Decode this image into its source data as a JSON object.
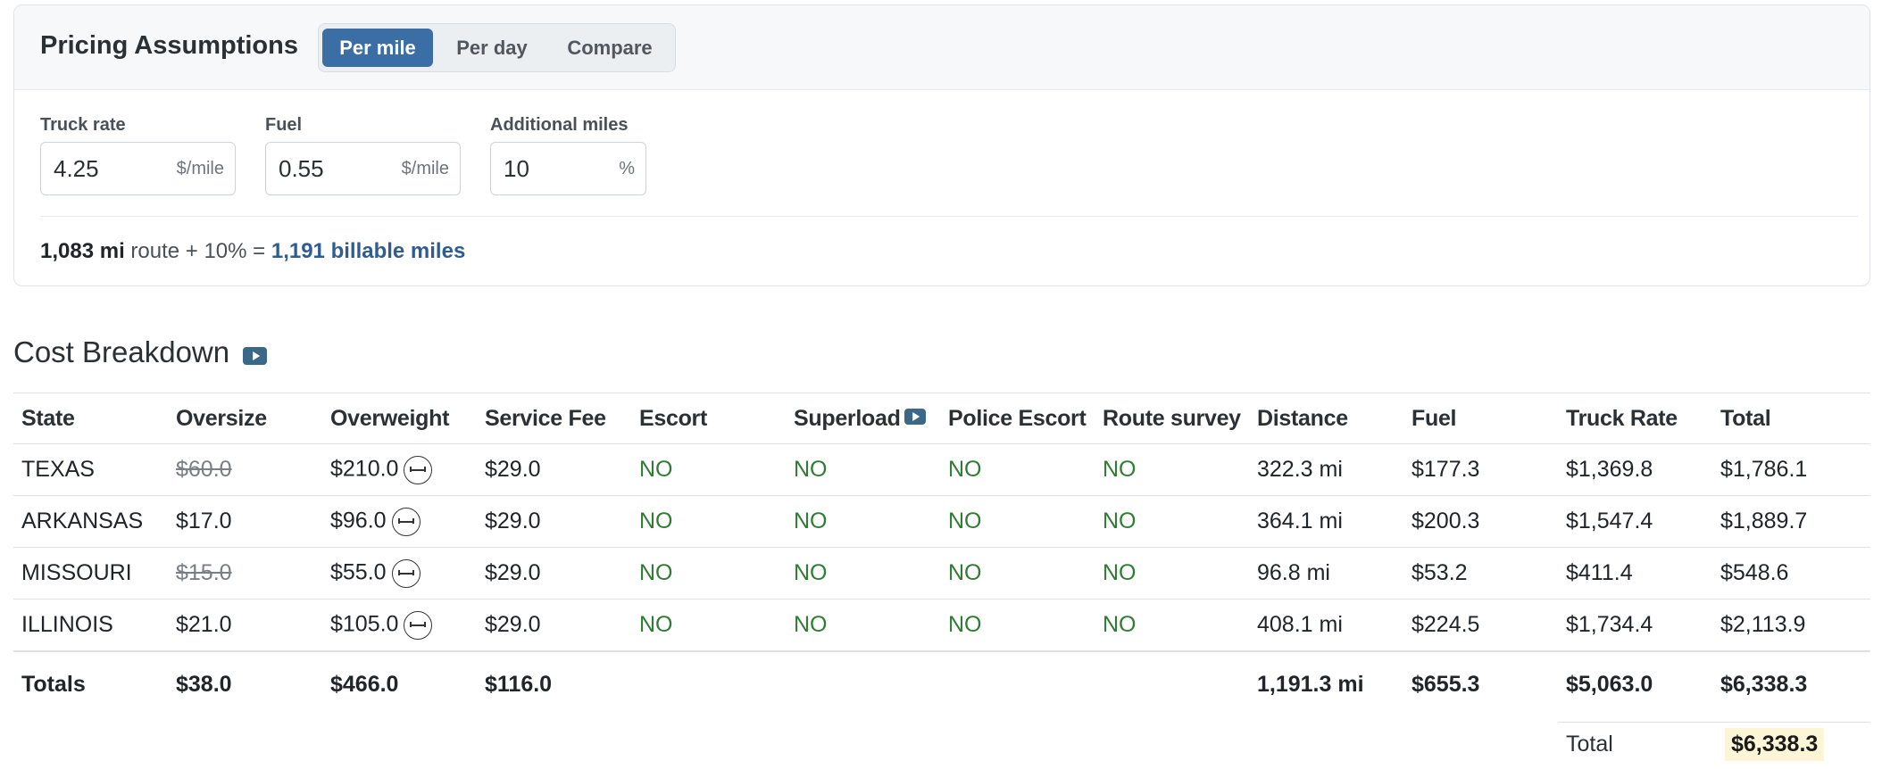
{
  "pricing": {
    "title": "Pricing Assumptions",
    "modes": [
      "Per mile",
      "Per day",
      "Compare"
    ],
    "active_mode": "Per mile",
    "fields": [
      {
        "label": "Truck rate",
        "value": "4.25",
        "unit": "$/mile"
      },
      {
        "label": "Fuel",
        "value": "0.55",
        "unit": "$/mile"
      },
      {
        "label": "Additional miles",
        "value": "10",
        "unit": "%"
      }
    ],
    "summary": {
      "route_miles": "1,083 mi",
      "middle": " route + 10% = ",
      "billable": "1,191 billable miles"
    }
  },
  "breakdown": {
    "title": "Cost Breakdown",
    "title_icon": "video-play-icon",
    "columns": [
      "State",
      "Oversize",
      "Overweight",
      "Service Fee",
      "Escort",
      "Superload",
      "Police Escort",
      "Route survey",
      "Distance",
      "Fuel",
      "Truck Rate",
      "Total"
    ],
    "superload_icon": "video-play-icon",
    "rows": [
      {
        "state": "TEXAS",
        "oversize": "$60.0",
        "oversize_struck": true,
        "overweight": "$210.0",
        "service_fee": "$29.0",
        "escort": "NO",
        "superload": "NO",
        "police_escort": "NO",
        "route_survey": "NO",
        "distance": "322.3 mi",
        "fuel": "$177.3",
        "truck_rate": "$1,369.8",
        "total": "$1,786.1"
      },
      {
        "state": "ARKANSAS",
        "oversize": "$17.0",
        "oversize_struck": false,
        "overweight": "$96.0",
        "service_fee": "$29.0",
        "escort": "NO",
        "superload": "NO",
        "police_escort": "NO",
        "route_survey": "NO",
        "distance": "364.1 mi",
        "fuel": "$200.3",
        "truck_rate": "$1,547.4",
        "total": "$1,889.7"
      },
      {
        "state": "MISSOURI",
        "oversize": "$15.0",
        "oversize_struck": true,
        "overweight": "$55.0",
        "service_fee": "$29.0",
        "escort": "NO",
        "superload": "NO",
        "police_escort": "NO",
        "route_survey": "NO",
        "distance": "96.8 mi",
        "fuel": "$53.2",
        "truck_rate": "$411.4",
        "total": "$548.6"
      },
      {
        "state": "ILLINOIS",
        "oversize": "$21.0",
        "oversize_struck": false,
        "overweight": "$105.0",
        "service_fee": "$29.0",
        "escort": "NO",
        "superload": "NO",
        "police_escort": "NO",
        "route_survey": "NO",
        "distance": "408.1 mi",
        "fuel": "$224.5",
        "truck_rate": "$1,734.4",
        "total": "$2,113.9"
      }
    ],
    "overweight_icon": "axle-icon",
    "totals": {
      "label": "Totals",
      "oversize": "$38.0",
      "overweight": "$466.0",
      "service_fee": "$116.0",
      "distance": "1,191.3 mi",
      "fuel": "$655.3",
      "truck_rate": "$5,063.0",
      "total": "$6,338.3"
    },
    "grand_total": {
      "label": "Total",
      "value": "$6,338.3"
    }
  },
  "colors": {
    "accent": "#3a6ea5",
    "no_status": "#2e7d32",
    "highlight": "#fdf6d6",
    "link": "#2f5d8f"
  }
}
